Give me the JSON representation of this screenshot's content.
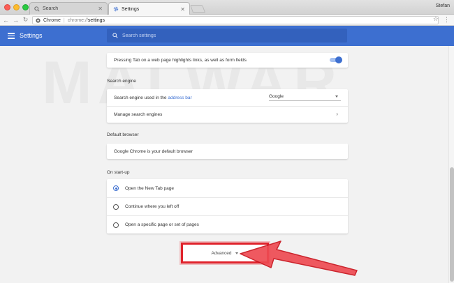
{
  "browser": {
    "tabs": [
      {
        "label": "Search",
        "active": false
      },
      {
        "label": "Settings",
        "active": true
      }
    ],
    "profile": "Stefan",
    "omnibox": {
      "scheme": "Chrome",
      "url_prefix": "chrome://",
      "url_path": "settings"
    }
  },
  "header": {
    "title": "Settings",
    "search_placeholder": "Search settings"
  },
  "accessibility": {
    "tab_highlight_label": "Pressing Tab on a web page highlights links, as well as form fields",
    "tab_highlight_enabled": true
  },
  "search_engine": {
    "section_title": "Search engine",
    "used_label_pre": "Search engine used in the",
    "used_label_link": "address bar",
    "selected": "Google",
    "manage_label": "Manage search engines"
  },
  "default_browser": {
    "section_title": "Default browser",
    "status": "Google Chrome is your default browser"
  },
  "on_startup": {
    "section_title": "On start-up",
    "options": [
      {
        "label": "Open the New Tab page",
        "checked": true
      },
      {
        "label": "Continue where you left off",
        "checked": false
      },
      {
        "label": "Open a specific page or set of pages",
        "checked": false
      }
    ]
  },
  "advanced": {
    "label": "Advanced"
  },
  "watermark": "MALWAR",
  "colors": {
    "accent": "#3d6fd0",
    "highlight": "#e0232c"
  }
}
